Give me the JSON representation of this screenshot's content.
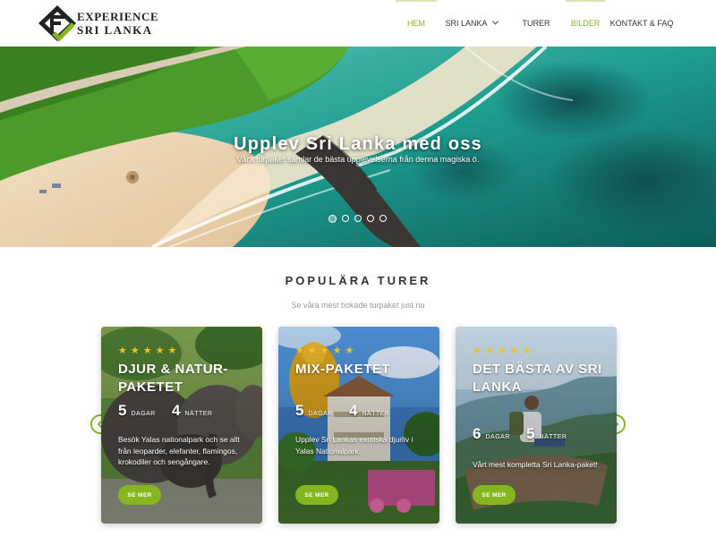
{
  "brand": {
    "line1": "EXPERIENCE",
    "line2": "SRI LANKA",
    "accent_color": "#86b61f"
  },
  "nav": {
    "items": [
      {
        "label": "HEM",
        "active": true
      },
      {
        "label": "SRI LANKA",
        "has_dropdown": true
      },
      {
        "label": "TURER"
      },
      {
        "label": "BILDER",
        "active": true
      },
      {
        "label": "KONTAKT & FAQ"
      }
    ]
  },
  "hero": {
    "title": "Upplev Sri Lanka med oss",
    "subtitle": "Våra turpaket samlar de bästa upplevelserna från denna magiska ö.",
    "slides": 5,
    "active_slide": 1
  },
  "section": {
    "title": "POPULÄRA TURER",
    "subtitle": "Se våra mest bokade turpaket just nu"
  },
  "cards": [
    {
      "rating": 5,
      "title": "DJUR & NATUR-PAKETET",
      "days": "5",
      "days_label": "DAGAR",
      "nights": "4",
      "nights_label": "NÄTTER",
      "description": "Besök Yalas nationalpark och se allt från leoparder, elefanter, flamingos, krokodiler och sengångare.",
      "button": "SE MER"
    },
    {
      "rating": 5,
      "title": "MIX-PAKETET",
      "days": "5",
      "days_label": "DAGAR",
      "nights": "4",
      "nights_label": "NÄTTER",
      "description": "Upplev Sri Lankas exotiska djurliv i Yalas Nationalpark.",
      "button": "SE MER"
    },
    {
      "rating": 5,
      "title": "DET BÄSTA AV SRI LANKA",
      "days": "6",
      "days_label": "DAGAR",
      "nights": "5",
      "nights_label": "NÄTTER",
      "description": "Vårt mest kompletta Sri Lanka-paket!",
      "button": "SE MER"
    }
  ],
  "carousel": {
    "prev_icon": "chevron-left-icon",
    "next_icon": "chevron-right-icon"
  }
}
